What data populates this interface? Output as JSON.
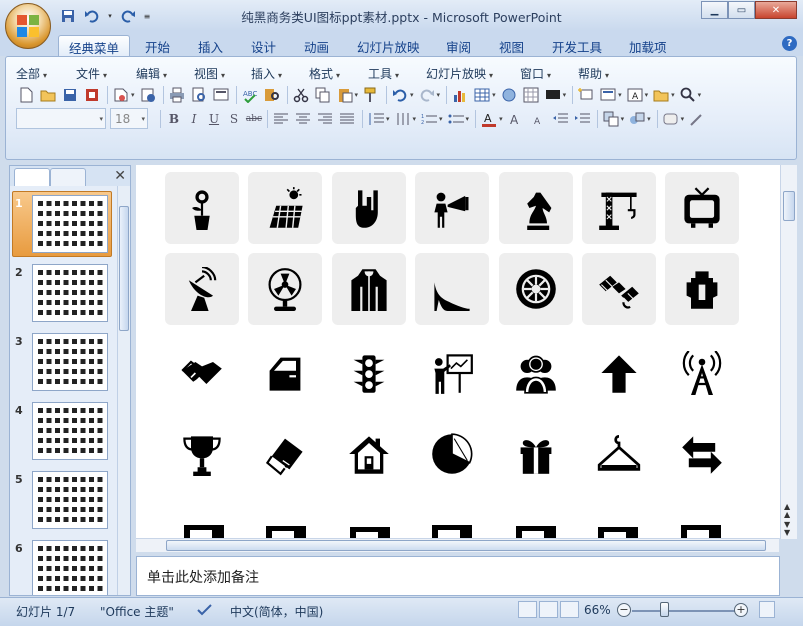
{
  "window": {
    "title": "纯黑商务类UI图标ppt素材.pptx - Microsoft PowerPoint",
    "controls": [
      "minimize",
      "maximize",
      "close"
    ]
  },
  "ribbon_tabs": [
    {
      "label": "经典菜单",
      "active": true
    },
    {
      "label": "开始",
      "active": false
    },
    {
      "label": "插入",
      "active": false
    },
    {
      "label": "设计",
      "active": false
    },
    {
      "label": "动画",
      "active": false
    },
    {
      "label": "幻灯片放映",
      "active": false
    },
    {
      "label": "审阅",
      "active": false
    },
    {
      "label": "视图",
      "active": false
    },
    {
      "label": "开发工具",
      "active": false
    },
    {
      "label": "加载项",
      "active": false
    }
  ],
  "classic_menu": [
    "全部",
    "文件",
    "编辑",
    "视图",
    "插入",
    "格式",
    "工具",
    "幻灯片放映",
    "窗口",
    "帮助"
  ],
  "format_bar": {
    "font_name": "",
    "font_size": "18",
    "bold": "B",
    "italic": "I",
    "underline": "U",
    "shadow": "S",
    "strike": "abc"
  },
  "slides_pane": {
    "slides": [
      {
        "number": "1",
        "active": true
      },
      {
        "number": "2",
        "active": false
      },
      {
        "number": "3",
        "active": false
      },
      {
        "number": "4",
        "active": false
      },
      {
        "number": "5",
        "active": false
      },
      {
        "number": "6",
        "active": false
      }
    ]
  },
  "slide": {
    "icons_row1": [
      "plant-pot-icon",
      "solar-panel-icon",
      "rock-hand-icon",
      "megaphone-person-icon",
      "chess-knight-icon",
      "construction-crane-icon",
      "television-icon"
    ],
    "icons_row2": [
      "satellite-dish-icon",
      "desk-fan-icon",
      "jacket-icon",
      "high-heel-icon",
      "tire-icon",
      "satellite-icon",
      "kettle-icon"
    ],
    "icons_row3": [
      "handshake-icon",
      "car-door-icon",
      "traffic-light-icon",
      "presentation-icon",
      "team-icon",
      "up-arrow-icon",
      "radio-tower-icon"
    ],
    "icons_row4": [
      "trophy-icon",
      "eraser-icon",
      "house-icon",
      "pie-icon",
      "gift-icon",
      "hanger-icon",
      "swap-arrows-icon"
    ]
  },
  "notes": {
    "placeholder": "单击此处添加备注"
  },
  "status": {
    "slide_info": "幻灯片 1/7",
    "theme": "\"Office 主题\"",
    "language": "中文(简体，中国)",
    "zoom": "66%"
  }
}
